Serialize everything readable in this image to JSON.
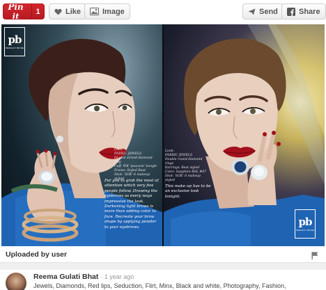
{
  "toolbar": {
    "pin_label": "Pin it",
    "pin_count": "1",
    "like_label": "Like",
    "image_label": "Image",
    "send_label": "Send",
    "share_label": "Share"
  },
  "photo": {
    "logo_mark": "pb",
    "logo_sub": "PERFECT BRIDE",
    "left_credits": "Look:\nFABRIC JEWELS\nDouble strand diamond ring\nCuff: WK 'peacock' bangle\nFrame: Styled Beat\nShot: 'SOK' 8 makeup styled",
    "left_copy": "For you to grab the most of attention which very few people follow. Drawing the eyebrows as every ways impressive the look. Darkening light brows is more than adding color to face. Recreate your brow shape by applying powder to your eyebrows.",
    "right_credits": "Look:\nFABRIC JEWELS\nDouble round diamond rings\nEarrings: Beat styled\nColor: Sapphire RSL #07\nShot: 'SOK' 8 makeup styled",
    "right_copy": "This make up has to be an exclusive look tonight."
  },
  "footer": {
    "uploaded_label": "Uploaded by user",
    "comment_author": "Reema Gulati Bhat",
    "comment_time": "· 1 year ago",
    "comment_tags": "Jewels, Diamonds, Red lips, Seduction, Flirt, Minx, Black and white, Photography, Fashion,"
  },
  "colors": {
    "pin_red": "#cb2027",
    "lip_red": "#a3101c",
    "dress_blue": "#1f63b3"
  },
  "icons": [
    "heart-icon",
    "image-icon",
    "send-icon",
    "facebook-icon",
    "flag-icon"
  ]
}
